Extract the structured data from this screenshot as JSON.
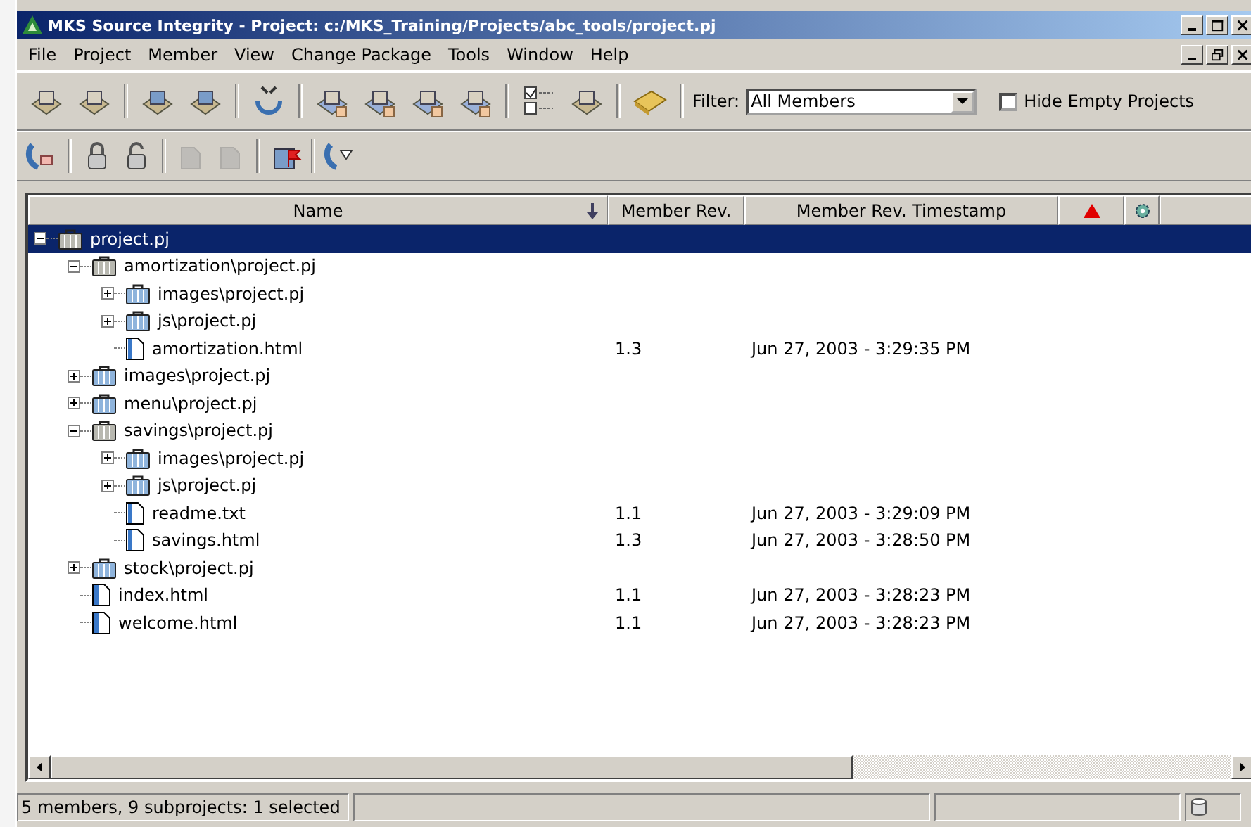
{
  "window": {
    "title": "MKS Source Integrity - Project: c:/MKS_Training/Projects/abc_tools/project.pj"
  },
  "menu": [
    "File",
    "Project",
    "Member",
    "View",
    "Change Package",
    "Tools",
    "Window",
    "Help"
  ],
  "toolbar_1": [
    [
      {
        "disabled": false
      },
      {
        "disabled": false
      }
    ],
    [
      {
        "disabled": false
      },
      {
        "disabled": false
      }
    ],
    [
      {
        "disabled": false
      }
    ],
    [
      {
        "disabled": false
      },
      {
        "disabled": false
      },
      {
        "disabled": false
      },
      {
        "disabled": false
      }
    ],
    [
      {
        "disabled": false
      },
      {
        "disabled": false
      }
    ],
    [
      {
        "disabled": false
      }
    ]
  ],
  "filter": {
    "label": "Filter:",
    "value": "All Members"
  },
  "hide_empty": {
    "label": "Hide Empty Projects",
    "checked": false
  },
  "toolbar_2": [
    [
      {
        "disabled": false
      }
    ],
    [
      {
        "disabled": false
      },
      {
        "disabled": false
      }
    ],
    [
      {
        "disabled": true
      },
      {
        "disabled": true
      }
    ],
    [
      {
        "disabled": false
      }
    ],
    [
      {
        "disabled": false
      }
    ]
  ],
  "columns": [
    {
      "label": "Name",
      "sorted": true
    },
    {
      "label": "Member Rev.",
      "sorted": false
    },
    {
      "label": "Member Rev. Timestamp",
      "sorted": false
    },
    {
      "kind": "warning"
    },
    {
      "kind": "gear"
    }
  ],
  "tree": [
    {
      "name": "project.pj",
      "kind": "project",
      "expanded": true,
      "selected": true,
      "children": [
        {
          "name": "amortization\\project.pj",
          "kind": "project",
          "expanded": true,
          "selected": false,
          "children": [
            {
              "name": "images\\project.pj",
              "kind": "subproject",
              "expanded": false,
              "selected": false
            },
            {
              "name": "js\\project.pj",
              "kind": "subproject",
              "expanded": false,
              "selected": false
            },
            {
              "name": "amortization.html",
              "kind": "file",
              "selected": false,
              "rev": "1.3",
              "timestamp": "Jun 27, 2003 - 3:29:35 PM"
            }
          ]
        },
        {
          "name": "images\\project.pj",
          "kind": "subproject",
          "expanded": false,
          "selected": false
        },
        {
          "name": "menu\\project.pj",
          "kind": "subproject",
          "expanded": false,
          "selected": false
        },
        {
          "name": "savings\\project.pj",
          "kind": "project",
          "expanded": true,
          "selected": false,
          "children": [
            {
              "name": "images\\project.pj",
              "kind": "subproject",
              "expanded": false,
              "selected": false
            },
            {
              "name": "js\\project.pj",
              "kind": "subproject",
              "expanded": false,
              "selected": false
            },
            {
              "name": "readme.txt",
              "kind": "file",
              "selected": false,
              "rev": "1.1",
              "timestamp": "Jun 27, 2003 - 3:29:09 PM"
            },
            {
              "name": "savings.html",
              "kind": "file",
              "selected": false,
              "rev": "1.3",
              "timestamp": "Jun 27, 2003 - 3:28:50 PM"
            }
          ]
        },
        {
          "name": "stock\\project.pj",
          "kind": "subproject",
          "expanded": false,
          "selected": false
        },
        {
          "name": "index.html",
          "kind": "file",
          "selected": false,
          "rev": "1.1",
          "timestamp": "Jun 27, 2003 - 3:28:23 PM"
        },
        {
          "name": "welcome.html",
          "kind": "file",
          "selected": false,
          "rev": "1.1",
          "timestamp": "Jun 27, 2003 - 3:28:23 PM"
        }
      ]
    }
  ],
  "status_bar": {
    "text": "5 members, 9 subprojects: 1 selected"
  }
}
